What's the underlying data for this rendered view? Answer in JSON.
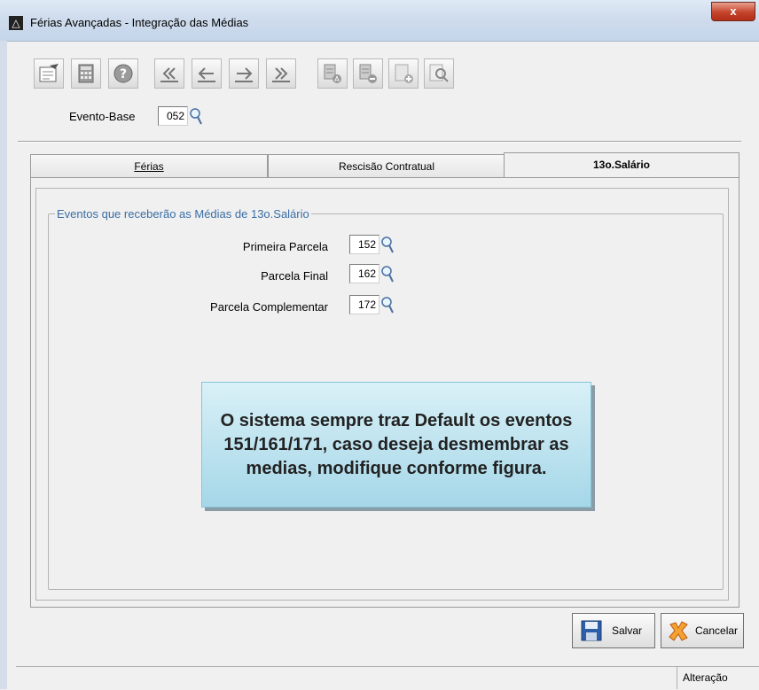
{
  "window": {
    "title": "Férias Avançadas - Integração das Médias",
    "close_label": "x"
  },
  "toolbar": {
    "buttons": [
      "edit-icon",
      "calculator-icon",
      "help-icon",
      "first-record-icon",
      "previous-record-icon",
      "next-record-icon",
      "last-record-icon",
      "add-item-icon",
      "remove-item-icon",
      "new-icon",
      "search-icon"
    ]
  },
  "evento_base": {
    "label": "Evento-Base",
    "value": "052"
  },
  "tabs": [
    {
      "label": "Férias",
      "active": false
    },
    {
      "label": "Rescisão Contratual",
      "active": false
    },
    {
      "label": "13o.Salário",
      "active": true
    }
  ],
  "group": {
    "title": "Eventos que receberão as Médias de 13o.Salário",
    "fields": [
      {
        "label": "Primeira Parcela",
        "value": "152"
      },
      {
        "label": "Parcela Final",
        "value": "162"
      },
      {
        "label": "Parcela Complementar",
        "value": "172"
      }
    ]
  },
  "callout": {
    "text": "O sistema sempre traz Default os eventos 151/161/171, caso deseja desmembrar as medias, modifique conforme figura."
  },
  "buttons": {
    "save": "Salvar",
    "cancel": "Cancelar"
  },
  "status": {
    "mode": "Alteração"
  }
}
